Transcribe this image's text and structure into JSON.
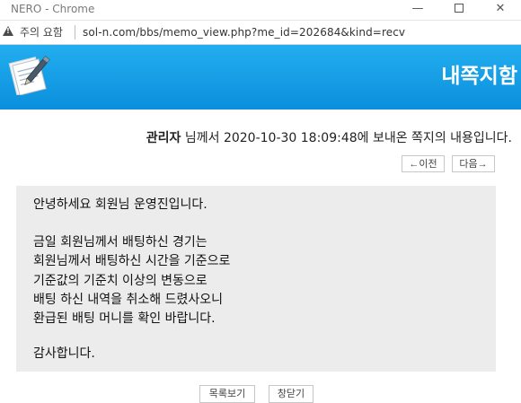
{
  "window": {
    "title": "NERO - Chrome",
    "minimize_glyph": "—",
    "close_glyph": "✕"
  },
  "addressbar": {
    "security_label": "주의 요함",
    "url": "sol-n.com/bbs/memo_view.php?me_id=202684&kind=recv"
  },
  "header": {
    "title": "내쪽지함"
  },
  "info": {
    "sender": "관리자",
    "text": " 님께서 2020-10-30 18:09:48에 보내온 쪽지의 내용입니다."
  },
  "nav": {
    "prev_label": "←이전",
    "next_label": "다음→"
  },
  "message": {
    "lines": [
      "안녕하세요 회원님 운영진입니다.",
      "금일 회원님께서 배팅하신 경기는",
      "회원님께서 배팅하신 시간을 기준으로",
      "기준값의 기준치 이상의 변동으로",
      "배팅 하신 내역을 취소해 드렸사오니",
      "환급된 배팅 머니를 확인 바랍니다.",
      "감사합니다."
    ]
  },
  "buttons": {
    "list_label": "목록보기",
    "close_label": "창닫기"
  },
  "colors": {
    "header_top": "#23aef0",
    "header_bottom": "#0a8fdc",
    "message_bg": "#ececec"
  },
  "icons": {
    "logo": "memo-paper-pen-icon",
    "warning": "warning-triangle-icon"
  }
}
